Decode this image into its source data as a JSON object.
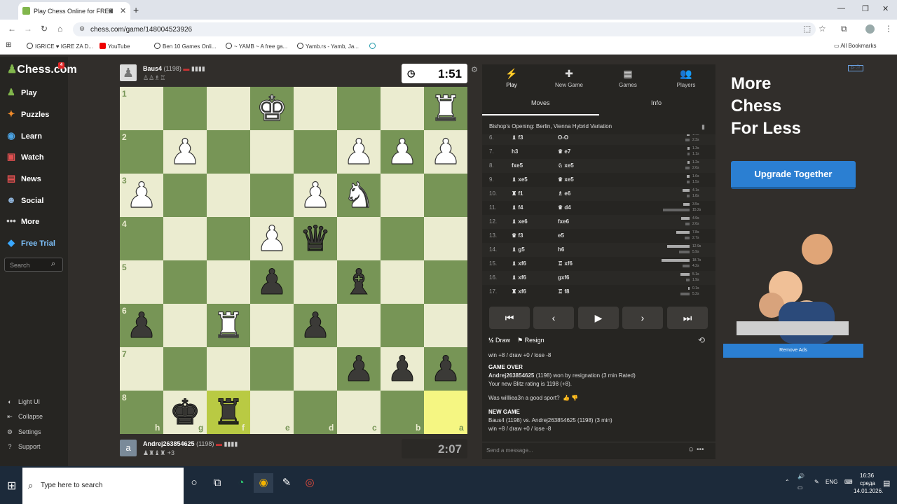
{
  "browser": {
    "tab_title": "Play Chess Online for FREE",
    "url": "chess.com/game/148004523926",
    "bookmarks": [
      "IGRICE ♥ IGRE ZA D...",
      "YouTube",
      "Ben 10 Games Onli...",
      "~ YAMB ~ A free ga...",
      "Yamb.rs - Yamb, Ja..."
    ],
    "all_bookmarks": "All Bookmarks"
  },
  "sidebar": {
    "logo": "Chess.com",
    "badge": "4",
    "items": [
      {
        "label": "Play",
        "icon": "play-icon"
      },
      {
        "label": "Puzzles",
        "icon": "puzzle-icon"
      },
      {
        "label": "Learn",
        "icon": "learn-icon"
      },
      {
        "label": "Watch",
        "icon": "watch-icon"
      },
      {
        "label": "News",
        "icon": "news-icon"
      },
      {
        "label": "Social",
        "icon": "social-icon"
      },
      {
        "label": "More",
        "icon": "more-icon"
      },
      {
        "label": "Free Trial",
        "icon": "diamond-icon"
      }
    ],
    "search_placeholder": "Search",
    "footer": [
      "Light UI",
      "Collapse",
      "Settings",
      "Support"
    ]
  },
  "top_player": {
    "name": "Baus4",
    "rating": "(1198)",
    "clock": "1:51"
  },
  "bottom_player": {
    "name": "Andrej263854625",
    "rating": "(1198)",
    "avatar_letter": "a",
    "material": "+3",
    "clock": "2:07"
  },
  "board": {
    "ranks": [
      "1",
      "2",
      "3",
      "4",
      "5",
      "6",
      "7",
      "8"
    ],
    "files": [
      "h",
      "g",
      "f",
      "e",
      "d",
      "c",
      "b",
      "a"
    ],
    "highlights": [
      [
        7,
        2
      ],
      [
        7,
        7
      ]
    ],
    "pieces": [
      {
        "r": 0,
        "c": 3,
        "g": "♚",
        "side": "w"
      },
      {
        "r": 0,
        "c": 7,
        "g": "♜",
        "side": "w"
      },
      {
        "r": 1,
        "c": 1,
        "g": "♟",
        "side": "w"
      },
      {
        "r": 1,
        "c": 5,
        "g": "♟",
        "side": "w"
      },
      {
        "r": 1,
        "c": 6,
        "g": "♟",
        "side": "w"
      },
      {
        "r": 1,
        "c": 7,
        "g": "♟",
        "side": "w"
      },
      {
        "r": 2,
        "c": 0,
        "g": "♟",
        "side": "w"
      },
      {
        "r": 2,
        "c": 4,
        "g": "♟",
        "side": "w"
      },
      {
        "r": 2,
        "c": 5,
        "g": "♞",
        "side": "w"
      },
      {
        "r": 3,
        "c": 3,
        "g": "♟",
        "side": "w"
      },
      {
        "r": 3,
        "c": 4,
        "g": "♛",
        "side": "b"
      },
      {
        "r": 4,
        "c": 3,
        "g": "♟",
        "side": "b"
      },
      {
        "r": 4,
        "c": 5,
        "g": "♝",
        "side": "b"
      },
      {
        "r": 5,
        "c": 0,
        "g": "♟",
        "side": "b"
      },
      {
        "r": 5,
        "c": 2,
        "g": "♜",
        "side": "w"
      },
      {
        "r": 5,
        "c": 4,
        "g": "♟",
        "side": "b"
      },
      {
        "r": 6,
        "c": 5,
        "g": "♟",
        "side": "b"
      },
      {
        "r": 6,
        "c": 6,
        "g": "♟",
        "side": "b"
      },
      {
        "r": 6,
        "c": 7,
        "g": "♟",
        "side": "b"
      },
      {
        "r": 7,
        "c": 1,
        "g": "♚",
        "side": "b"
      },
      {
        "r": 7,
        "c": 2,
        "g": "♜",
        "side": "b"
      }
    ]
  },
  "panel": {
    "tabs": [
      {
        "label": "Play",
        "icon": "⚡"
      },
      {
        "label": "New Game",
        "icon": "✚"
      },
      {
        "label": "Games",
        "icon": "▦"
      },
      {
        "label": "Players",
        "icon": "👥"
      }
    ],
    "subtabs": [
      "Moves",
      "Info"
    ],
    "opening": "Bishop's Opening: Berlin, Vienna Hybrid Variation",
    "moves": [
      {
        "n": "6.",
        "w": "♝ f3",
        "b": "O-O",
        "t1": "1.6s",
        "t2": "2.3s"
      },
      {
        "n": "7.",
        "w": "h3",
        "b": "♛ e7",
        "t1": "1.3s",
        "t2": "1.1s"
      },
      {
        "n": "8.",
        "w": "fxe5",
        "b": "♘ xe5",
        "t1": "1.2s",
        "t2": "2.6s"
      },
      {
        "n": "9.",
        "w": "♝ xe5",
        "b": "♛ xe5",
        "t1": "1.6s",
        "t2": "1.5s"
      },
      {
        "n": "10.",
        "w": "♜ f1",
        "b": "♗ e6",
        "t1": "4.1s",
        "t2": "1.8s"
      },
      {
        "n": "11.",
        "w": "♝ f4",
        "b": "♛ d4",
        "t1": "3.5s",
        "t2": "15.2s"
      },
      {
        "n": "12.",
        "w": "♝ xe6",
        "b": "fxe6",
        "t1": "4.9s",
        "t2": "2.6s"
      },
      {
        "n": "13.",
        "w": "♛ f3",
        "b": "e5",
        "t1": "7.8s",
        "t2": "2.7s"
      },
      {
        "n": "14.",
        "w": "♝ g5",
        "b": "h6",
        "t1": "12.9s",
        "t2": "5.9s"
      },
      {
        "n": "15.",
        "w": "♝ xf6",
        "b": "♖ xf6",
        "t1": "18.7s",
        "t2": "4.2s"
      },
      {
        "n": "16.",
        "w": "♝ xf6",
        "b": "gxf6",
        "t1": "5.1s",
        "t2": "1.9s"
      },
      {
        "n": "17.",
        "w": "♜ xf6",
        "b": "♖ f8",
        "t1": "0.1s",
        "t2": "5.2s"
      }
    ],
    "draw_label": "Draw",
    "resign_label": "Resign",
    "chat": {
      "line1": "win +8 / draw +0 / lose -8",
      "gameover": "GAME OVER",
      "winner": "Andrej263854625",
      "result": " (1198) won by resignation (3 min Rated)",
      "rating_line": "Your new Blitz rating is 1198 (+8).",
      "sport_q": "Was willliea3n a good sport?",
      "newgame": "NEW GAME",
      "matchup": "Baus4 (1198) vs. Andrej263854625 (1198) (3 min)",
      "line2": "win +8 / draw +0 / lose -8"
    },
    "message_placeholder": "Send a message..."
  },
  "ad": {
    "headline1": "More",
    "headline2": "Chess",
    "headline3": "For Less",
    "button": "Upgrade Together",
    "remove": "Remove Ads"
  },
  "taskbar": {
    "search_placeholder": "Type here to search",
    "lang": "ENG",
    "time": "16:36",
    "day": "среда",
    "date": "14.01.2026."
  }
}
